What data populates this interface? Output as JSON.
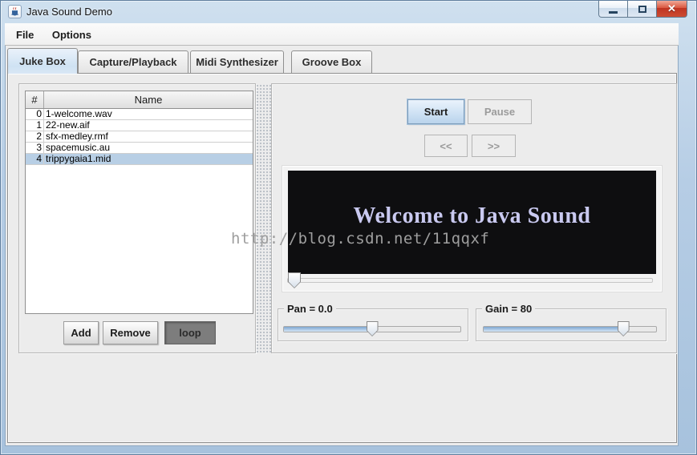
{
  "window": {
    "title": "Java Sound Demo"
  },
  "icons": {
    "close": "✕"
  },
  "menu": {
    "items": [
      {
        "label": "File"
      },
      {
        "label": "Options"
      }
    ]
  },
  "tabs": [
    {
      "label": "Juke Box",
      "selected": true
    },
    {
      "label": "Capture/Playback",
      "selected": false
    },
    {
      "label": "Midi Synthesizer",
      "selected": false
    },
    {
      "label": "Groove Box",
      "selected": false
    }
  ],
  "juke_box": {
    "table": {
      "columns": [
        "#",
        "Name"
      ],
      "rows": [
        {
          "num": "0",
          "name": "1-welcome.wav"
        },
        {
          "num": "1",
          "name": "22-new.aif"
        },
        {
          "num": "2",
          "name": "sfx-medley.rmf"
        },
        {
          "num": "3",
          "name": "spacemusic.au"
        },
        {
          "num": "4",
          "name": "trippygaia1.mid"
        }
      ],
      "selected_row": 4
    },
    "buttons": {
      "add": "Add",
      "remove": "Remove",
      "loop": "loop"
    },
    "transport": {
      "start": "Start",
      "pause": "Pause",
      "prev": "<<",
      "next": ">>"
    },
    "display": {
      "message": "Welcome to Java Sound",
      "seek_percent": 0
    },
    "pan": {
      "label": "Pan = 0.0",
      "value": 0.0,
      "percent": 50
    },
    "gain": {
      "label": "Gain = 80",
      "value": 80,
      "percent": 81
    }
  },
  "watermark": {
    "text": "http://blog.csdn.net/11qqxf"
  },
  "colors": {
    "selection": "#b8cfe5",
    "display_text": "#c9c9f0",
    "slider_fill": "#7fa6cf",
    "close_button": "#bf3421",
    "tab_selected": "#cfe2f3"
  }
}
